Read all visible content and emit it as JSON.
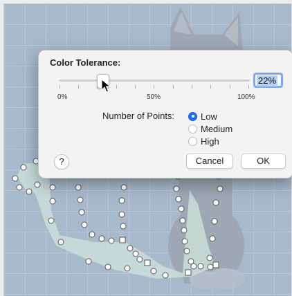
{
  "dialog": {
    "title": "Color Tolerance:",
    "slider": {
      "value_percent": 22,
      "min_label": "0%",
      "mid_label": "50%",
      "max_label": "100%"
    },
    "value_field": "22%",
    "points": {
      "label": "Number of Points:",
      "options": [
        {
          "label": "Low",
          "selected": true
        },
        {
          "label": "Medium",
          "selected": false
        },
        {
          "label": "High",
          "selected": false
        }
      ]
    },
    "help_label": "?",
    "cancel_label": "Cancel",
    "ok_label": "OK"
  },
  "colors": {
    "canvas": "#a8b9cc",
    "accent": "#1f6feb",
    "selection_fill": "#cfe6dc"
  },
  "icons": [
    "arrow-cursor-icon",
    "circle-handle-icon",
    "square-handle-icon"
  ]
}
